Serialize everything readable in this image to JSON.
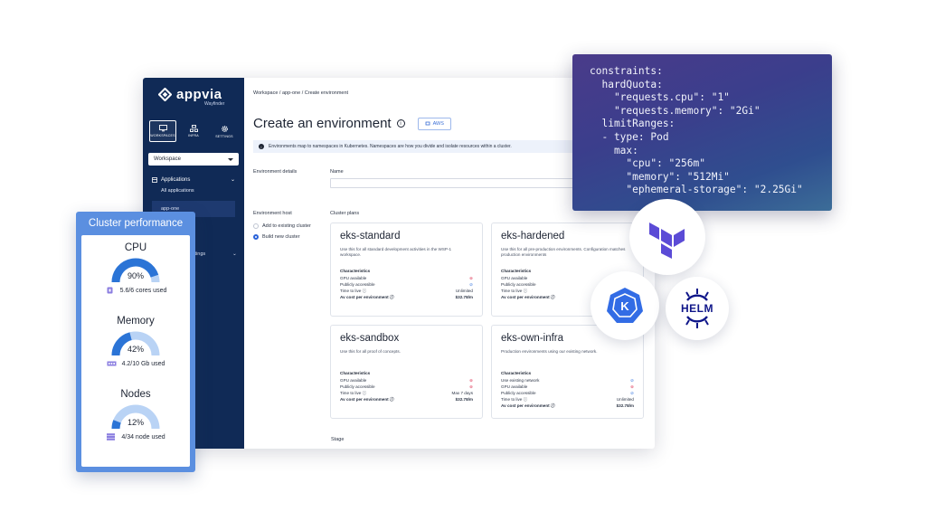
{
  "app": {
    "logo_text": "appvia",
    "logo_sub": "Wayfinder",
    "nav_tabs": [
      {
        "label": "WORKSPACES",
        "icon": "monitor-icon",
        "active": true
      },
      {
        "label": "INFRA",
        "icon": "infra-icon",
        "active": false
      },
      {
        "label": "SETTINGS",
        "icon": "gear-icon",
        "active": false
      }
    ],
    "workspace_select": "Workspace",
    "sidebar": {
      "section": "Applications",
      "items": [
        "All applications",
        "app-one"
      ],
      "settings_fragment": "ttings"
    }
  },
  "breadcrumb": "Workspace  /  app-one  /  Create environment",
  "page": {
    "title": "Create an environment",
    "badge": "AWS",
    "banner": "Environments map to namespaces in Kubernetes. Namespaces are how you divide and isolate resources within a cluster.",
    "env_details_label": "Environment details",
    "name_label": "Name",
    "env_host_label": "Environment host",
    "host_options": [
      "Add to existing cluster",
      "Build new cluster"
    ],
    "host_selected": "Build new cluster",
    "cluster_plans_label": "Cluster plans",
    "stage_label": "Stage"
  },
  "plans": [
    {
      "name": "eks-standard",
      "desc": "Use this for all standard development activities in the WSP-1 workspace.",
      "chars_title": "Characteristics",
      "rows": [
        {
          "label": "GPU available",
          "value": "",
          "icon": "x"
        },
        {
          "label": "Publicly accessible",
          "value": "",
          "icon": "ok"
        },
        {
          "label": "Time to live",
          "value": "Unlimited",
          "icon": ""
        },
        {
          "label": "Av cost per environment",
          "value": "$32.78/m",
          "icon": "",
          "bold": true
        }
      ]
    },
    {
      "name": "eks-hardened",
      "desc": "Use this for all pre-production environments. Configuration matches production environments",
      "chars_title": "Characteristics",
      "rows": [
        {
          "label": "GPU available",
          "value": "",
          "icon": ""
        },
        {
          "label": "Publicly accessible",
          "value": "",
          "icon": ""
        },
        {
          "label": "Time to live",
          "value": "",
          "icon": ""
        },
        {
          "label": "Av cost per environment",
          "value": "",
          "icon": "",
          "bold": true
        }
      ]
    },
    {
      "name": "eks-sandbox",
      "desc": "Use this for all proof of concepts.",
      "chars_title": "Characteristics",
      "rows": [
        {
          "label": "GPU available",
          "value": "",
          "icon": "x"
        },
        {
          "label": "Publicly accessible",
          "value": "",
          "icon": "x"
        },
        {
          "label": "Time to live",
          "value": "Max 7 days",
          "icon": ""
        },
        {
          "label": "Av cost per environment",
          "value": "$32.78/m",
          "icon": "",
          "bold": true
        }
      ]
    },
    {
      "name": "eks-own-infra",
      "desc": "Production environments using our existing network.",
      "chars_title": "Characteristics",
      "rows": [
        {
          "label": "Use existing network",
          "value": "",
          "icon": "ok"
        },
        {
          "label": "GPU available",
          "value": "",
          "icon": "x"
        },
        {
          "label": "Publicly accessible",
          "value": "",
          "icon": "ok"
        },
        {
          "label": "Time to live",
          "value": "Unlimited",
          "icon": ""
        },
        {
          "label": "Av cost per environment",
          "value": "$32.78/m",
          "icon": "",
          "bold": true
        }
      ]
    }
  ],
  "code": "constraints:\n  hardQuota:\n    \"requests.cpu\": \"1\"\n    \"requests.memory\": \"2Gi\"\n  limitRanges:\n  - type: Pod\n    max:\n      \"cpu\": \"256m\"\n      \"memory\": \"512Mi\"\n      \"ephemeral-storage\": \"2.25Gi\"",
  "logos": {
    "helm": "HELM",
    "k8s_letter": "K"
  },
  "perf": {
    "title": "Cluster performance",
    "metrics": [
      {
        "name": "CPU",
        "value": "90%",
        "fraction": 0.9,
        "sub": "5.6/6 cores used",
        "icon": "chip-icon"
      },
      {
        "name": "Memory",
        "value": "42%",
        "fraction": 0.42,
        "sub": "4.2/10 Gb used",
        "icon": "ram-icon"
      },
      {
        "name": "Nodes",
        "value": "12%",
        "fraction": 0.12,
        "sub": "4/34 node used",
        "icon": "server-icon"
      }
    ]
  },
  "colors": {
    "navy": "#102a56",
    "accent": "#5b8fe0",
    "gauge_fill": "#2b74d6",
    "gauge_track": "#b9d3f5"
  }
}
